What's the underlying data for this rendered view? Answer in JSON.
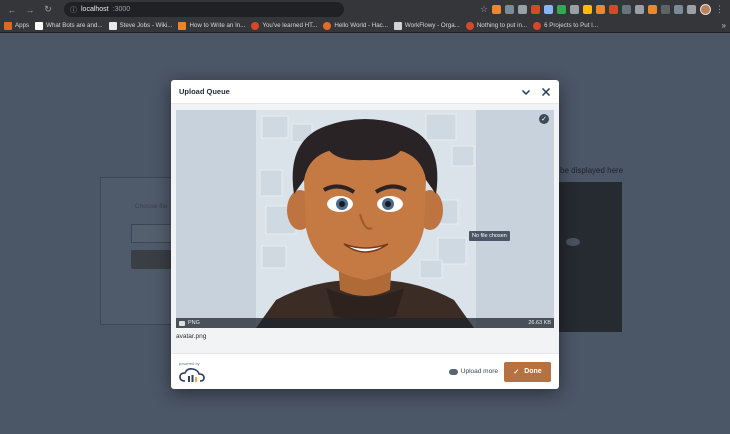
{
  "browser": {
    "url_host": "localhost",
    "url_port": ":3000",
    "bookmarks": [
      {
        "label": "Apps",
        "color": "#d36b2d"
      },
      {
        "label": "What Bots are and...",
        "color": "#ffffff"
      },
      {
        "label": "Steve Jobs - Wiki...",
        "color": "#e8e8e8"
      },
      {
        "label": "How to Write an In...",
        "color": "#e8862e"
      },
      {
        "label": "You've learned HT...",
        "color": "#d9472b"
      },
      {
        "label": "Hello World - Hac...",
        "color": "#e36b2c"
      },
      {
        "label": "WorkFlowy - Orga...",
        "color": "#cfd3d8"
      },
      {
        "label": "Nothing to put in...",
        "color": "#d9472b"
      },
      {
        "label": "6 Projects to Put I...",
        "color": "#d9472b"
      }
    ],
    "more_glyph": "»",
    "kebab_glyph": "⋮"
  },
  "page": {
    "choose_file_label": "Choose file",
    "display_text": "be displayed here"
  },
  "modal": {
    "title": "Upload Queue",
    "no_file_tooltip": "No file chosen",
    "image_tag": "PNG",
    "file_size": "26.63 KB",
    "file_name": "avatar.png",
    "powered_by": "powered by",
    "upload_more_label": "Upload more",
    "done_label": "Done",
    "accent_color": "#b5713f"
  }
}
